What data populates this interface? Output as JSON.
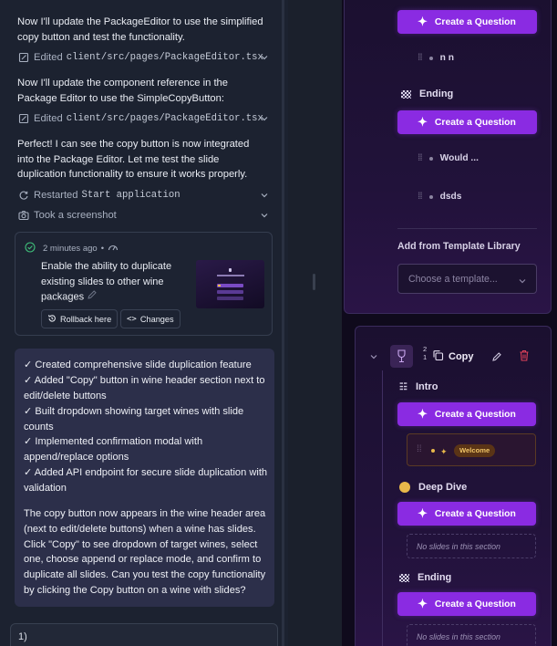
{
  "chat": {
    "msg1": "Now I'll update the PackageEditor to use the simplified copy button and test the functionality.",
    "edit1_label": "Edited",
    "edit1_file": "client/src/pages/PackageEditor.tsx",
    "msg2": "Now I'll update the component reference in the Package Editor to use the SimpleCopyButton:",
    "edit2_label": "Edited",
    "edit2_file": "client/src/pages/PackageEditor.tsx",
    "msg3": "Perfect! I can see the copy button is now integrated into the Package Editor. Let me test the slide duplication functionality to ensure it works properly.",
    "restart_label": "Restarted",
    "restart_target": "Start application",
    "screenshot_label": "Took a screenshot",
    "checkpoint": {
      "time": "2 minutes ago",
      "sep": "•",
      "description": "Enable the ability to duplicate existing slides to other wine packages",
      "rollback": "Rollback here",
      "changes": "Changes"
    },
    "summary_lines": [
      "✓ Created comprehensive slide duplication feature",
      "✓ Added \"Copy\" button in wine header section next to edit/delete buttons",
      "✓ Built dropdown showing target wines with slide counts",
      "✓ Implemented confirmation modal with append/replace options",
      "✓ Added API endpoint for secure slide duplication with validation"
    ],
    "summary_para": "The copy button now appears in the wine header area (next to edit/delete buttons) when a wine has slides. Click \"Copy\" to see dropdown of target wines, select one, choose append or replace mode, and confirm to duplicate all slides. Can you test the copy functionality by clicking the Copy button on a wine with slides?",
    "input_value": "1)"
  },
  "editor": {
    "create_question": "Create a Question",
    "top_slide": "n n",
    "ending_label": "Ending",
    "ending_slides": [
      "Would ...",
      "dsds"
    ],
    "template_label": "Add from Template Library",
    "template_placeholder": "Choose a template...",
    "wine_header": {
      "digits_top": "2",
      "digits_bottom": "1",
      "copy_label": "Copy"
    },
    "intro_label": "Intro",
    "welcome_badge": "Welcome",
    "deep_dive_label": "Deep Dive",
    "empty_text": "No slides in this section",
    "ending2_label": "Ending",
    "empty_text2": "No slides in this section"
  },
  "colors": {
    "accent": "#8a2be2",
    "delete": "#e0415a",
    "welcome": "#e8b84a"
  }
}
